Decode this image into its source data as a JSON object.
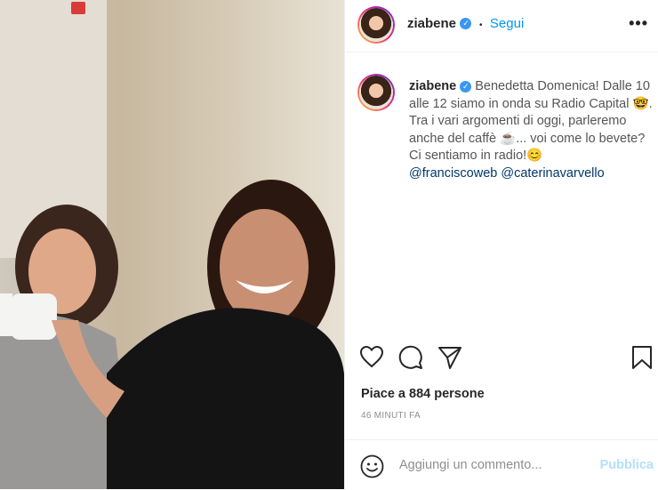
{
  "post": {
    "username": "ziabene",
    "separator": "•",
    "follow_label": "Segui",
    "more_label": "•••",
    "caption": {
      "username": "ziabene",
      "text_1": "Benedetta Domenica! Dalle 10 alle 12 siamo in onda su Radio Capital",
      "text_2": ". Tra i vari argomenti di oggi, parleremo anche del caffè",
      "text_3": "... voi come lo bevete? Ci sentiamo in radio!",
      "mention_1": "@franciscoweb",
      "mention_2": "@caterinavarvello"
    },
    "likes": "Piace a 884 persone",
    "time": "46 MINUTI FA",
    "comment_placeholder": "Aggiungi un commento...",
    "publish_label": "Pubblica"
  },
  "colors": {
    "link": "#0095f6",
    "mention": "#00376b",
    "verified": "#3897f0",
    "publish_disabled": "#b2dffc"
  }
}
